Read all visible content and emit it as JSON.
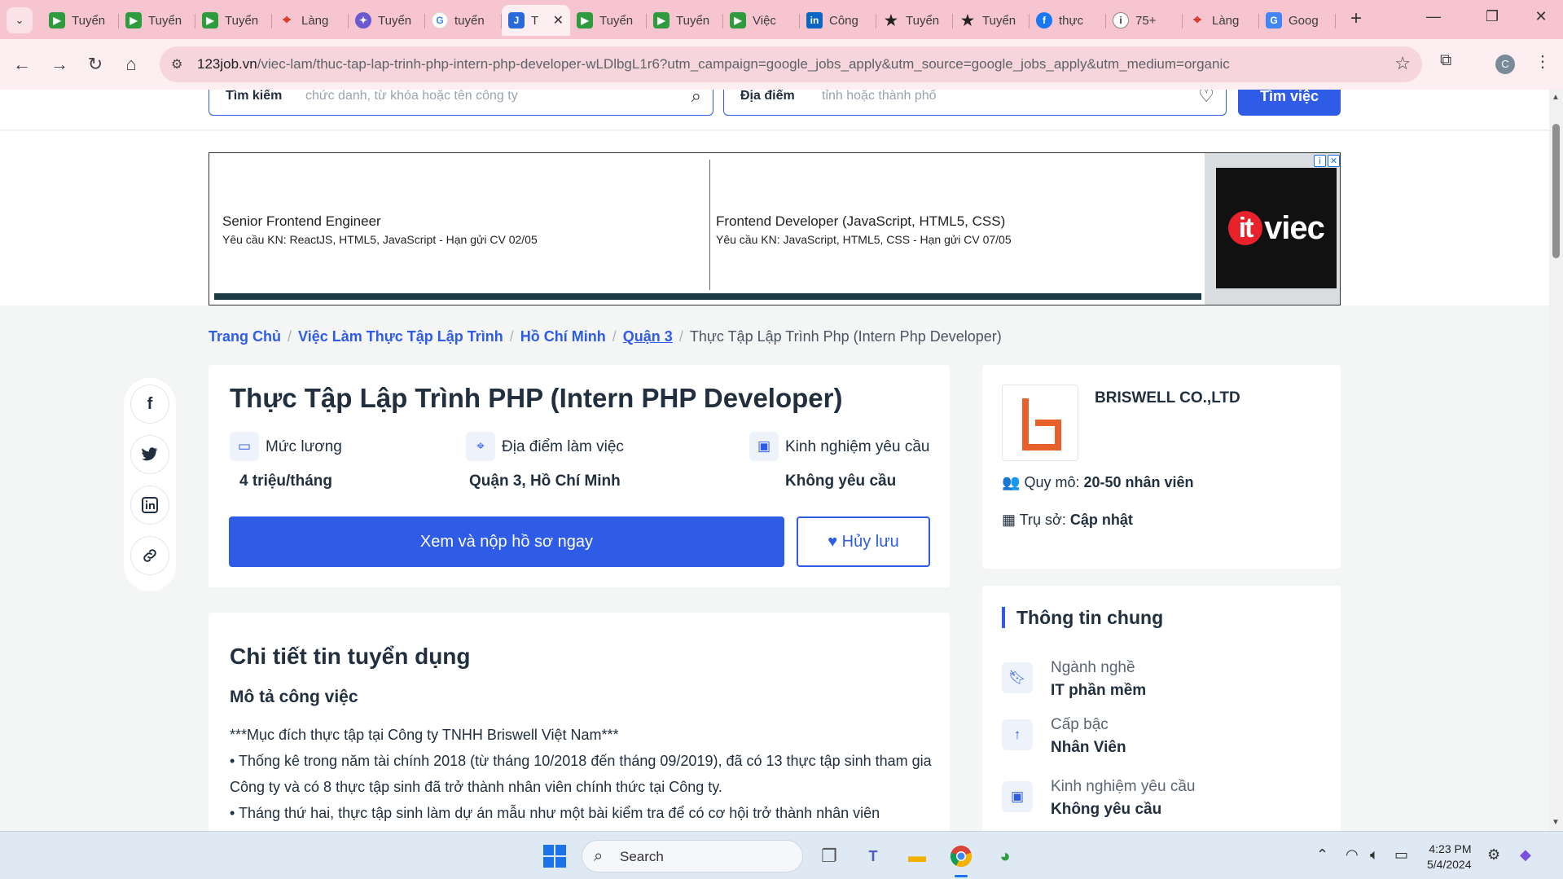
{
  "browser": {
    "tabs": [
      {
        "icon": "123job-icon",
        "title": "Tuyển",
        "active": false
      },
      {
        "icon": "123job-icon",
        "title": "Tuyển",
        "active": false
      },
      {
        "icon": "123job-icon",
        "title": "Tuyển",
        "active": false
      },
      {
        "icon": "maps-pin-icon",
        "title": "Làng",
        "active": false
      },
      {
        "icon": "multicolor-star-icon",
        "title": "Tuyển",
        "active": false
      },
      {
        "icon": "google-icon",
        "title": "tuyển",
        "active": false
      },
      {
        "icon": "job-j-icon",
        "title": "T",
        "active": true
      },
      {
        "icon": "123job-icon",
        "title": "Tuyển",
        "active": false
      },
      {
        "icon": "123job-icon",
        "title": "Tuyển",
        "active": false
      },
      {
        "icon": "123job-icon",
        "title": "Việc",
        "active": false
      },
      {
        "icon": "linkedin-icon",
        "title": "Công",
        "active": false
      },
      {
        "icon": "black-star-icon",
        "title": "Tuyển",
        "active": false
      },
      {
        "icon": "black-star-icon",
        "title": "Tuyển",
        "active": false
      },
      {
        "icon": "facebook-icon",
        "title": "thực",
        "active": false
      },
      {
        "icon": "info-icon",
        "title": "75+",
        "active": false
      },
      {
        "icon": "maps-pin-icon",
        "title": "Làng",
        "active": false
      },
      {
        "icon": "google-translate-icon",
        "title": "Goog",
        "active": false
      }
    ],
    "url_host": "123job.vn",
    "url_path": "/viec-lam/thuc-tap-lap-trinh-php-intern-php-developer-wLDlbgL1r6?utm_campaign=google_jobs_apply&utm_source=google_jobs_apply&utm_medium=organic",
    "profile_initial": "C"
  },
  "search": {
    "keyword_label": "Tìm kiếm",
    "keyword_placeholder": "chức danh, từ khóa hoặc tên công ty",
    "location_label": "Địa điểm",
    "location_placeholder": "tỉnh hoặc thành phố",
    "button": "Tìm việc"
  },
  "ad": {
    "items": [
      {
        "title": "Senior Frontend Engineer",
        "subtitle": "Yêu cầu KN: ReactJS, HTML5, JavaScript - Hạn gửi CV 02/05"
      },
      {
        "title": "Frontend Developer (JavaScript, HTML5, CSS)",
        "subtitle": "Yêu cầu KN: JavaScript, HTML5, CSS - Hạn gửi CV 07/05"
      }
    ],
    "brand_badge": "it",
    "brand_text": "viec"
  },
  "breadcrumb": {
    "items": [
      "Trang Chủ",
      "Việc Làm Thực Tập Lập Trình",
      "Hồ Chí Minh",
      "Quận 3"
    ],
    "current": "Thực Tập Lập Trình Php (Intern Php Developer)"
  },
  "job": {
    "title": "Thực Tập Lập Trình PHP (Intern PHP Developer)",
    "salary_label": "Mức lương",
    "salary_value": "4 triệu/tháng",
    "location_label": "Địa điểm làm việc",
    "location_value": "Quận 3, Hồ Chí Minh",
    "experience_label": "Kinh nghiệm yêu cầu",
    "experience_value": "Không yêu cầu",
    "apply_button": "Xem và nộp hồ sơ ngay",
    "save_button": "Hủy lưu"
  },
  "company": {
    "name": "BRISWELL CO.,LTD",
    "size_label": "Quy mô:",
    "size_value": "20-50 nhân viên",
    "hq_label": "Trụ sở:",
    "hq_value": "Cập nhật",
    "logo_color": "#e8612c"
  },
  "details": {
    "heading": "Chi tiết tin tuyển dụng",
    "subheading": "Mô tả công việc",
    "lines": [
      "***Mục đích thực tập tại Công ty TNHH Briswell Việt Nam***",
      "• Thống kê trong năm tài chính 2018 (từ tháng 10/2018 đến tháng 09/2019), đã có 13 thực tập sinh tham gia Công ty và có 8 thực tập sinh đã trở thành nhân viên chính thức tại Công ty.",
      "• Tháng thứ hai, thực tập sinh làm dự án mẫu như một bài kiểm tra để có cơ hội trở thành nhân viên"
    ]
  },
  "general_info": {
    "heading": "Thông tin chung",
    "items": [
      {
        "icon": "bookmark-icon",
        "label": "Ngành nghề",
        "value": "IT phần mềm"
      },
      {
        "icon": "arrow-up-icon",
        "label": "Cấp bậc",
        "value": "Nhân Viên"
      },
      {
        "icon": "briefcase-icon",
        "label": "Kinh nghiệm yêu cầu",
        "value": "Không yêu cầu"
      }
    ]
  },
  "taskbar": {
    "search_label": "Search",
    "time": "4:23 PM",
    "date": "5/4/2024"
  },
  "colors": {
    "accent": "#2e5ce6",
    "tabbar": "#f6c5d0",
    "toolbar": "#fdeef2"
  }
}
